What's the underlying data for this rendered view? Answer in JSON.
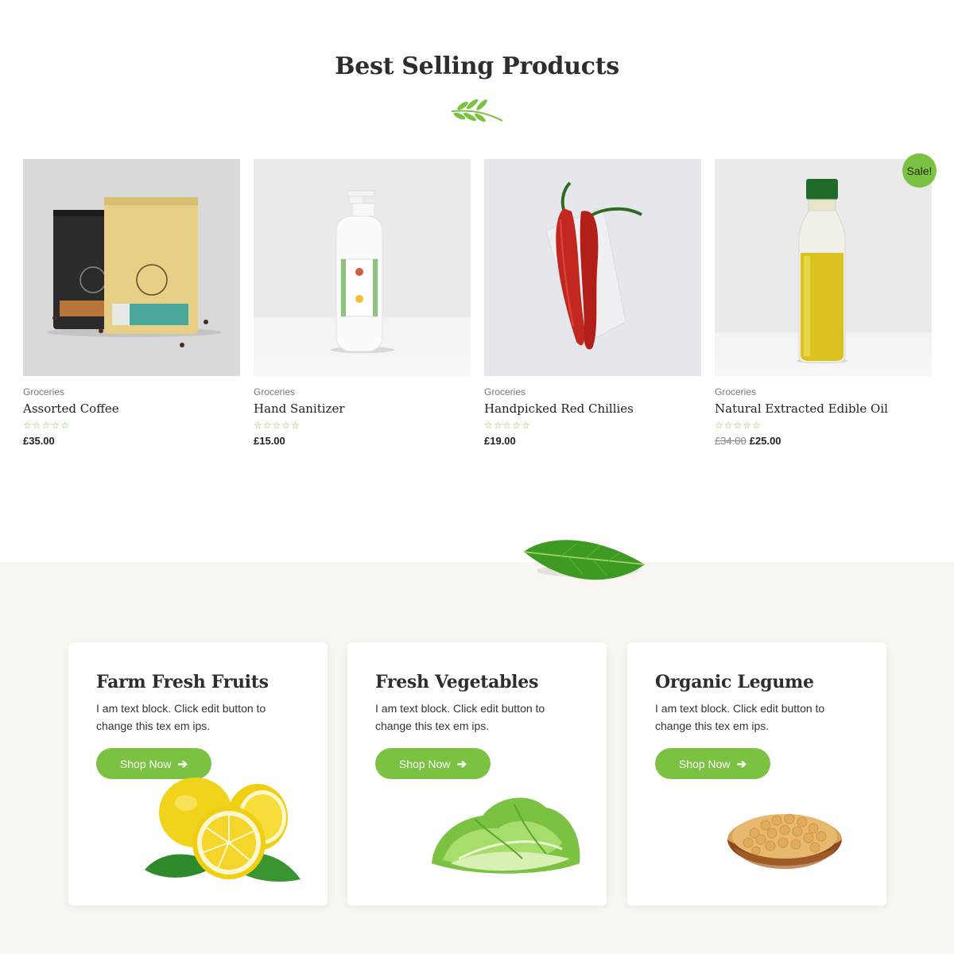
{
  "section": {
    "heading": "Best Selling Products"
  },
  "products": [
    {
      "category": "Groceries",
      "name": "Assorted Coffee",
      "rating": 0,
      "price": "£35.00"
    },
    {
      "category": "Groceries",
      "name": "Hand Sanitizer",
      "rating": 0,
      "price": "£15.00"
    },
    {
      "category": "Groceries",
      "name": "Handpicked Red Chillies",
      "rating": 0,
      "price": "£19.00"
    },
    {
      "category": "Groceries",
      "name": "Natural Extracted Edible Oil",
      "rating": 0,
      "old_price": "£34.00",
      "price": "£25.00",
      "badge": "Sale!"
    }
  ],
  "stars_glyphs": "☆☆☆☆☆",
  "categories": [
    {
      "title": "Farm Fresh Fruits",
      "text": "I am text block. Click edit button to change this tex em ips.",
      "button": "Shop Now",
      "icon": "arrow-right-icon"
    },
    {
      "title": "Fresh Vegetables",
      "text": "I am text block. Click edit button to change this tex em ips.",
      "button": "Shop Now",
      "icon": "arrow-right-icon"
    },
    {
      "title": "Organic Legume",
      "text": "I am text block. Click edit button to change this tex em ips.",
      "button": "Shop Now",
      "icon": "arrow-right-icon"
    }
  ],
  "colors": {
    "accent": "#7cc242",
    "section_bg": "#f8f6f0",
    "heading": "#2d2d2d"
  }
}
